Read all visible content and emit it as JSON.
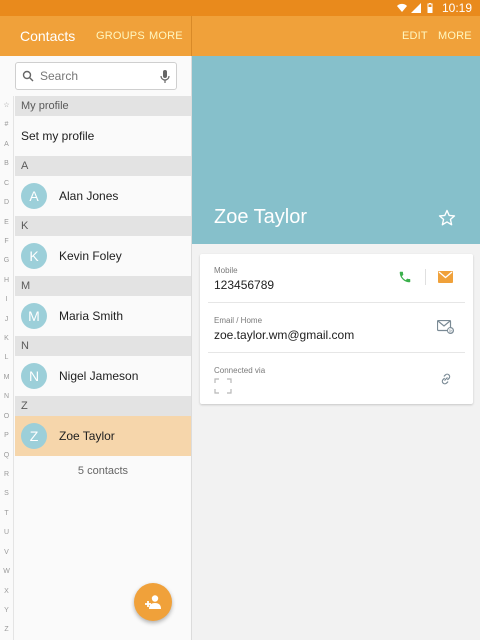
{
  "status": {
    "time": "10:19"
  },
  "app_bar": {
    "title": "Contacts",
    "left_actions": [
      "GROUPS",
      "MORE"
    ],
    "right_actions": [
      "EDIT",
      "MORE"
    ]
  },
  "search": {
    "placeholder": "Search"
  },
  "alpha_index": [
    "☆",
    "#",
    "A",
    "B",
    "C",
    "D",
    "E",
    "F",
    "G",
    "H",
    "I",
    "J",
    "K",
    "L",
    "M",
    "N",
    "O",
    "P",
    "Q",
    "R",
    "S",
    "T",
    "U",
    "V",
    "W",
    "X",
    "Y",
    "Z"
  ],
  "contacts": {
    "my_profile_header": "My profile",
    "set_profile": "Set my profile",
    "groups": [
      {
        "letter": "A",
        "name": "Alan Jones",
        "initial": "A"
      },
      {
        "letter": "K",
        "name": "Kevin Foley",
        "initial": "K"
      },
      {
        "letter": "M",
        "name": "Maria Smith",
        "initial": "M"
      },
      {
        "letter": "N",
        "name": "Nigel Jameson",
        "initial": "N"
      },
      {
        "letter": "Z",
        "name": "Zoe Taylor",
        "initial": "Z",
        "selected": true
      }
    ],
    "count": "5 contacts"
  },
  "detail": {
    "name": "Zoe Taylor",
    "mobile_label": "Mobile",
    "mobile_value": "123456789",
    "email_label": "Email / Home",
    "email_value": "zoe.taylor.wm@gmail.com",
    "connected_label": "Connected via"
  },
  "colors": {
    "status_bar": "#e98a1c",
    "app_bar": "#f0a13a",
    "hero": "#86c0cb",
    "avatar": "#9ccfd9",
    "selected_row": "#f6d6ab",
    "call_icon": "#3bb04c"
  },
  "icons": [
    "wifi-icon",
    "signal-icon",
    "battery-icon",
    "search-icon",
    "mic-icon",
    "add-contact-icon",
    "star-icon",
    "phone-icon",
    "message-icon",
    "email-icon",
    "connected-placeholder-icon",
    "link-icon"
  ]
}
